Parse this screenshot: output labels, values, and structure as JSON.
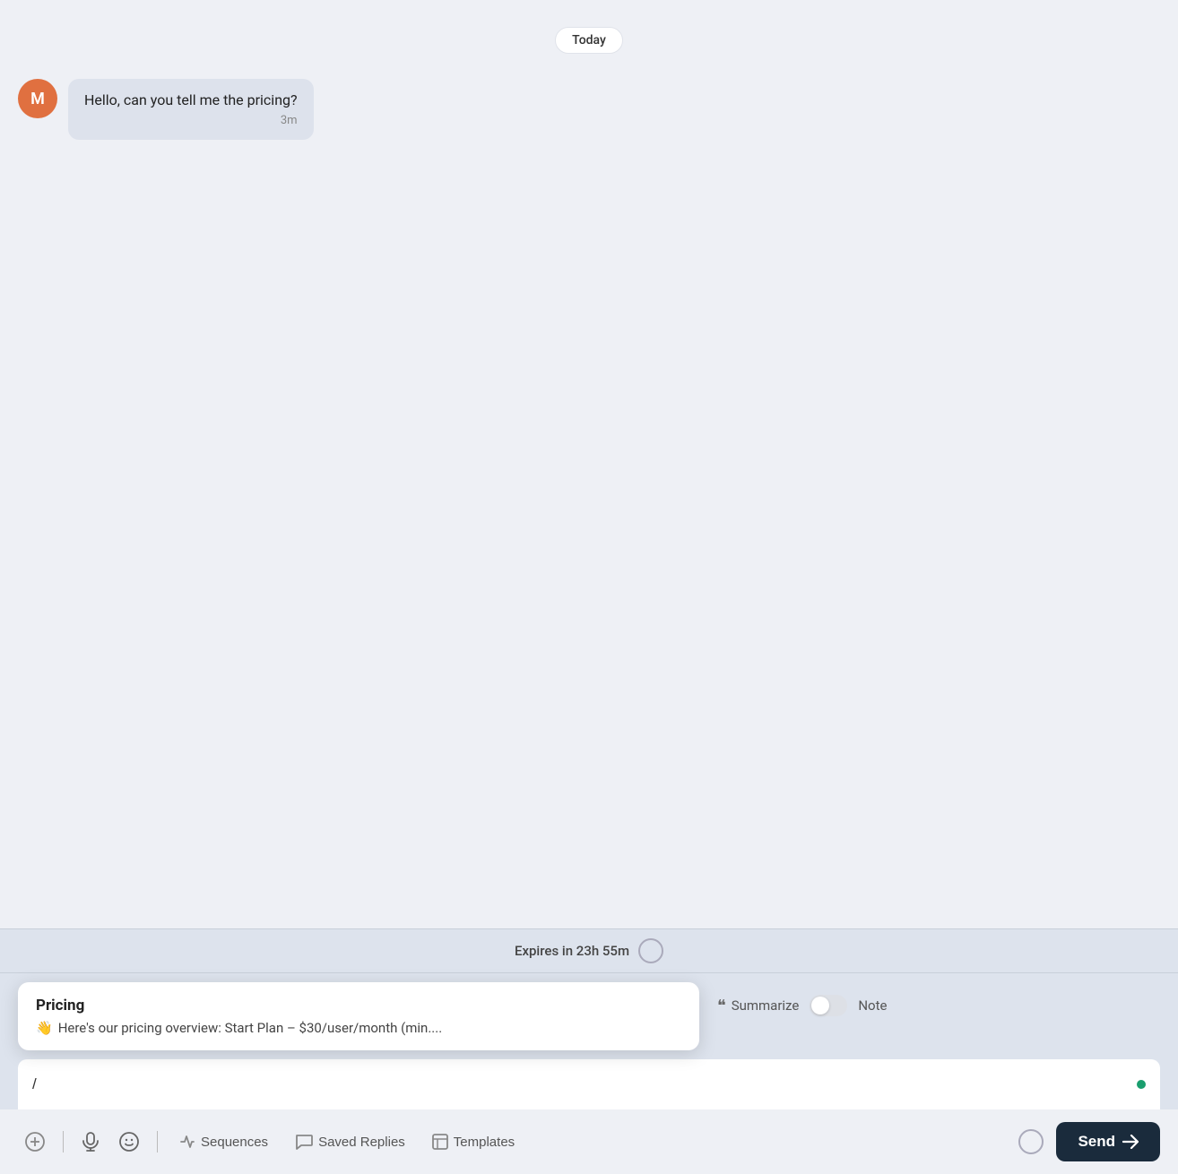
{
  "chat": {
    "date_badge": "Today",
    "messages": [
      {
        "avatar_letter": "M",
        "text": "Hello, can you tell me the pricing?",
        "time": "3m"
      }
    ]
  },
  "expires": {
    "label": "Expires in 23h 55m"
  },
  "suggestion": {
    "title": "Pricing",
    "emoji": "👋",
    "body": "Here's our pricing overview: Start Plan – $30/user/month (min...."
  },
  "compose": {
    "slash": "/",
    "green_dot_visible": true
  },
  "toolbar": {
    "summarize_label": "Summarize",
    "note_label": "Note",
    "add_icon": "+",
    "sequences_label": "Sequences",
    "saved_replies_label": "Saved Replies",
    "templates_label": "Templates",
    "send_label": "Send"
  }
}
